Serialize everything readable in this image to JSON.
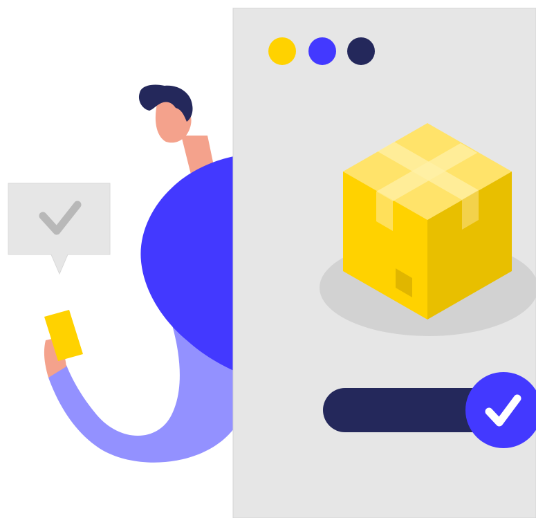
{
  "colors": {
    "background": "#ffffff",
    "window": "#e6e6e6",
    "window_border": "#d4d4d4",
    "dot_yellow": "#ffd200",
    "dot_blue": "#4339ff",
    "dot_navy": "#24285b",
    "box_front": "#ffd200",
    "box_side": "#e8bf00",
    "box_top": "#ffe36a",
    "box_tape": "#fff0a8",
    "box_shadow": "#d2d2d2",
    "progress_track": "#24285b",
    "check_circle": "#4339ff",
    "check_mark": "#ffffff",
    "shirt": "#4339ff",
    "sleeve": "#9391ff",
    "skin": "#f4a28c",
    "hair": "#24285b",
    "bubble": "#e6e6e6",
    "bubble_check": "#b8b8b8",
    "card": "#ffd200"
  },
  "window": {
    "dots": [
      {
        "icon": "yellow-dot"
      },
      {
        "icon": "blue-dot"
      },
      {
        "icon": "navy-dot"
      }
    ],
    "package_icon": "package-box-icon",
    "progress": {
      "value": 1.0,
      "status_icon": "check-icon"
    }
  },
  "person": {
    "speech_bubble_icon": "check-icon",
    "held_item": "card"
  }
}
